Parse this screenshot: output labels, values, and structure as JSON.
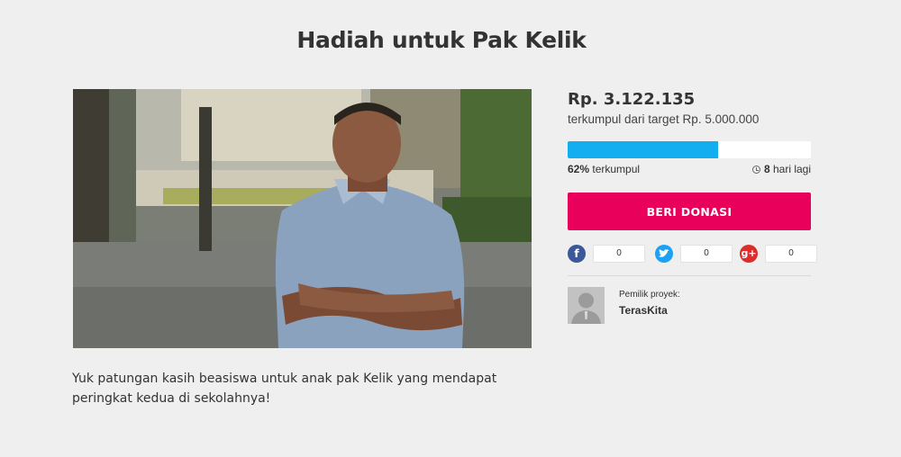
{
  "page": {
    "title": "Hadiah untuk Pak Kelik",
    "description": "Yuk patungan kasih beasiswa untuk anak pak Kelik yang mendapat peringkat kedua di sekolahnya!"
  },
  "campaign": {
    "amount": "Rp. 3.122.135",
    "target_text": "terkumpul dari target Rp. 5.000.000",
    "progress_percent": 62,
    "progress_label_value": "62%",
    "progress_label_text": " terkumpul",
    "days_value": "8",
    "days_text": " hari lagi",
    "donate_label": "BERI DONASI"
  },
  "share": {
    "facebook": {
      "icon": "facebook-icon",
      "count": "0",
      "color": "#3b5998"
    },
    "twitter": {
      "icon": "twitter-icon",
      "count": "0",
      "color": "#1da1f2"
    },
    "google_plus": {
      "icon": "google-plus-icon",
      "count": "0",
      "color": "#dd2c2c"
    }
  },
  "owner": {
    "label": "Pemilik proyek:",
    "name": "TerasKita"
  },
  "colors": {
    "accent": "#e8005b",
    "progress": "#13aef0",
    "background": "#efefef"
  }
}
